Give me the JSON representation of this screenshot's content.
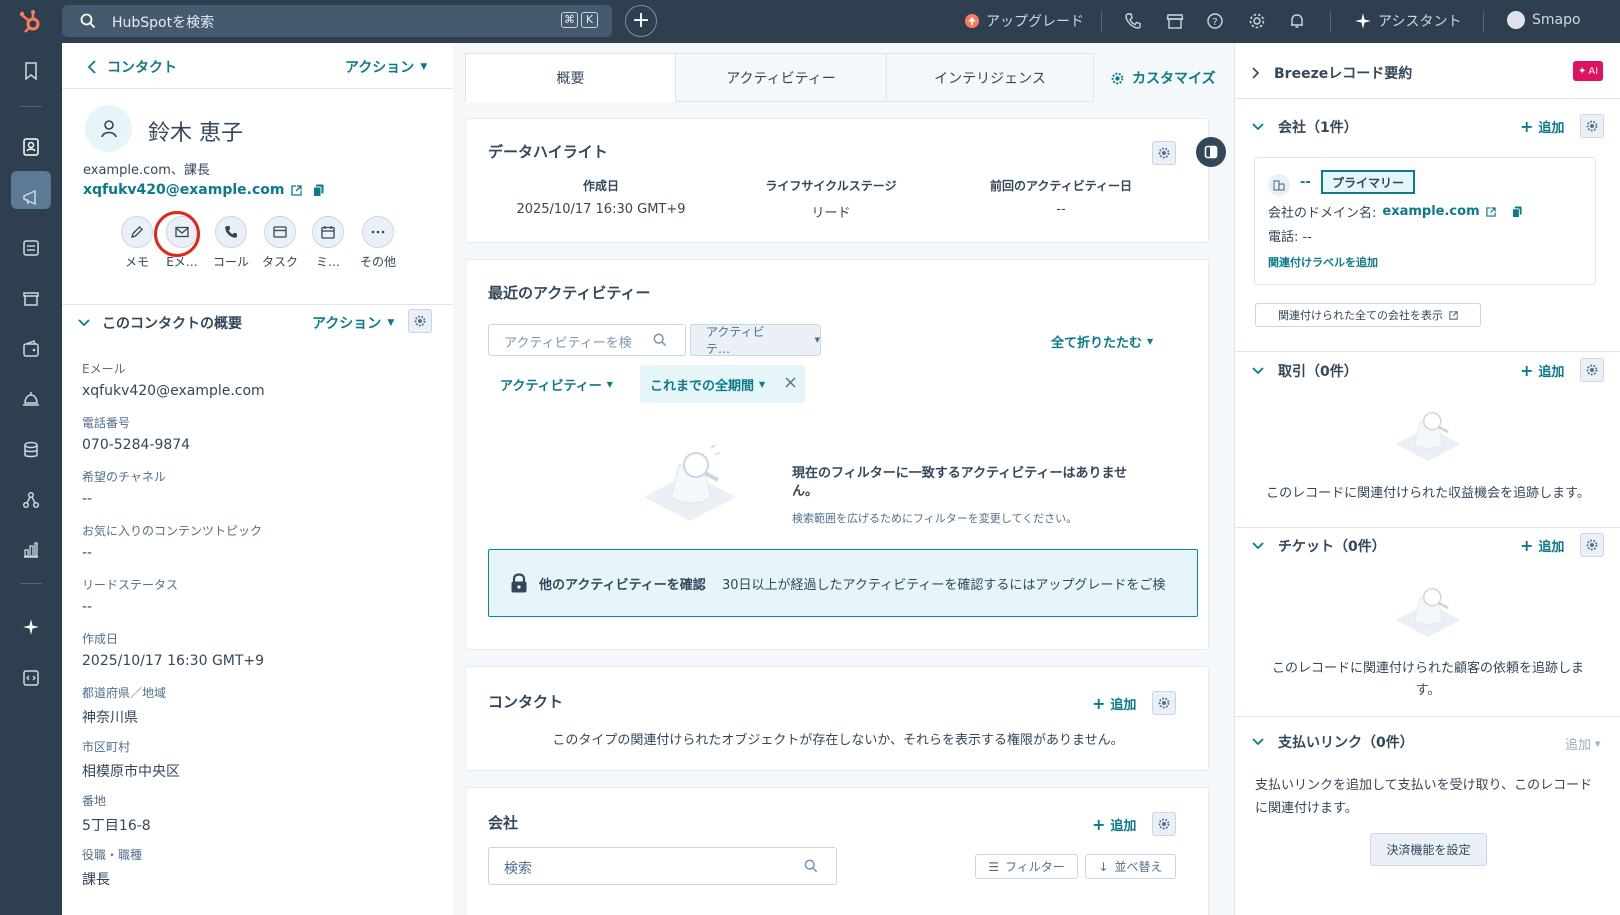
{
  "topbar": {
    "search_placeholder": "HubSpotを検索",
    "kbd": [
      "⌘",
      "K"
    ],
    "upgrade": "アップグレード",
    "assistant": "アシスタント",
    "account": "Smapo"
  },
  "contact": {
    "back_label": "コンタクト",
    "actions_label": "アクション",
    "name": "鈴木 恵子",
    "subtitle": "example.com、課長",
    "email_link": "xqfukv420@example.com",
    "quick_actions": [
      "メモ",
      "Eメ…",
      "コール",
      "タスク",
      "ミ…",
      "その他"
    ]
  },
  "summary": {
    "title": "このコンタクトの概要",
    "actions_label": "アクション",
    "fields": [
      {
        "label": "Eメール",
        "value": "xqfukv420@example.com"
      },
      {
        "label": "電話番号",
        "value": "070-5284-9874"
      },
      {
        "label": "希望のチャネル",
        "value": "--"
      },
      {
        "label": "お気に入りのコンテンツトピック",
        "value": "--"
      },
      {
        "label": "リードステータス",
        "value": "--"
      },
      {
        "label": "作成日",
        "value": "2025/10/17 16:30 GMT+9"
      },
      {
        "label": "都道府県／地域",
        "value": "神奈川県"
      },
      {
        "label": "市区町村",
        "value": "相模原市中央区"
      },
      {
        "label": "番地",
        "value": "5丁目16-8"
      },
      {
        "label": "役職・職種",
        "value": "課長"
      }
    ]
  },
  "tabs": [
    "概要",
    "アクティビティー",
    "インテリジェンス"
  ],
  "customize_label": "カスタマイズ",
  "highlights": {
    "title": "データハイライト",
    "cols": [
      {
        "label": "作成日",
        "value": "2025/10/17 16:30 GMT+9"
      },
      {
        "label": "ライフサイクルステージ",
        "value": "リード"
      },
      {
        "label": "前回のアクティビティー日",
        "value": "--"
      }
    ]
  },
  "recent": {
    "title": "最近のアクティビティー",
    "search_placeholder": "アクティビティーを検",
    "type_dropdown": "アクティビテ…",
    "collapse_all": "全て折りたたむ",
    "activity_filter": "アクティビティー",
    "period_filter": "これまでの全期間",
    "empty_title": "現在のフィルターに一致するアクティビティーはありません。",
    "empty_sub": "検索範囲を広げるためにフィルターを変更してください。",
    "upgrade_title": "他のアクティビティーを確認",
    "upgrade_text": "30日以上が経過したアクティビティーを確認するにはアップグレードをご検"
  },
  "contacts_card": {
    "title": "コンタクト",
    "add": "追加",
    "empty": "このタイプの関連付けられたオブジェクトが存在しないか、それらを表示する権限がありません。"
  },
  "company_card": {
    "title": "会社",
    "add": "追加",
    "search_placeholder": "検索",
    "filter": "フィルター",
    "sort": "並べ替え"
  },
  "right": {
    "breeze_title": "Breezeレコード要約",
    "ai_badge": "AI",
    "company": {
      "title": "会社（1件）",
      "add": "追加",
      "name": "--",
      "primary": "プライマリー",
      "domain_label": "会社のドメイン名: ",
      "domain": "example.com",
      "phone": "電話: --",
      "assoc_label": "関連付けラベルを追加",
      "view_all": "関連付けられた全ての会社を表示"
    },
    "deals": {
      "title": "取引（0件）",
      "add": "追加",
      "empty": "このレコードに関連付けられた収益機会を追跡します。"
    },
    "tickets": {
      "title": "チケット（0件）",
      "add": "追加",
      "empty": "このレコードに関連付けられた顧客の依頼を追跡します。"
    },
    "payments": {
      "title": "支払いリンク（0件）",
      "add": "追加",
      "empty": "支払いリンクを追加して支払いを受け取り、このレコードに関連付けます。",
      "button": "決済機能を設定"
    }
  }
}
